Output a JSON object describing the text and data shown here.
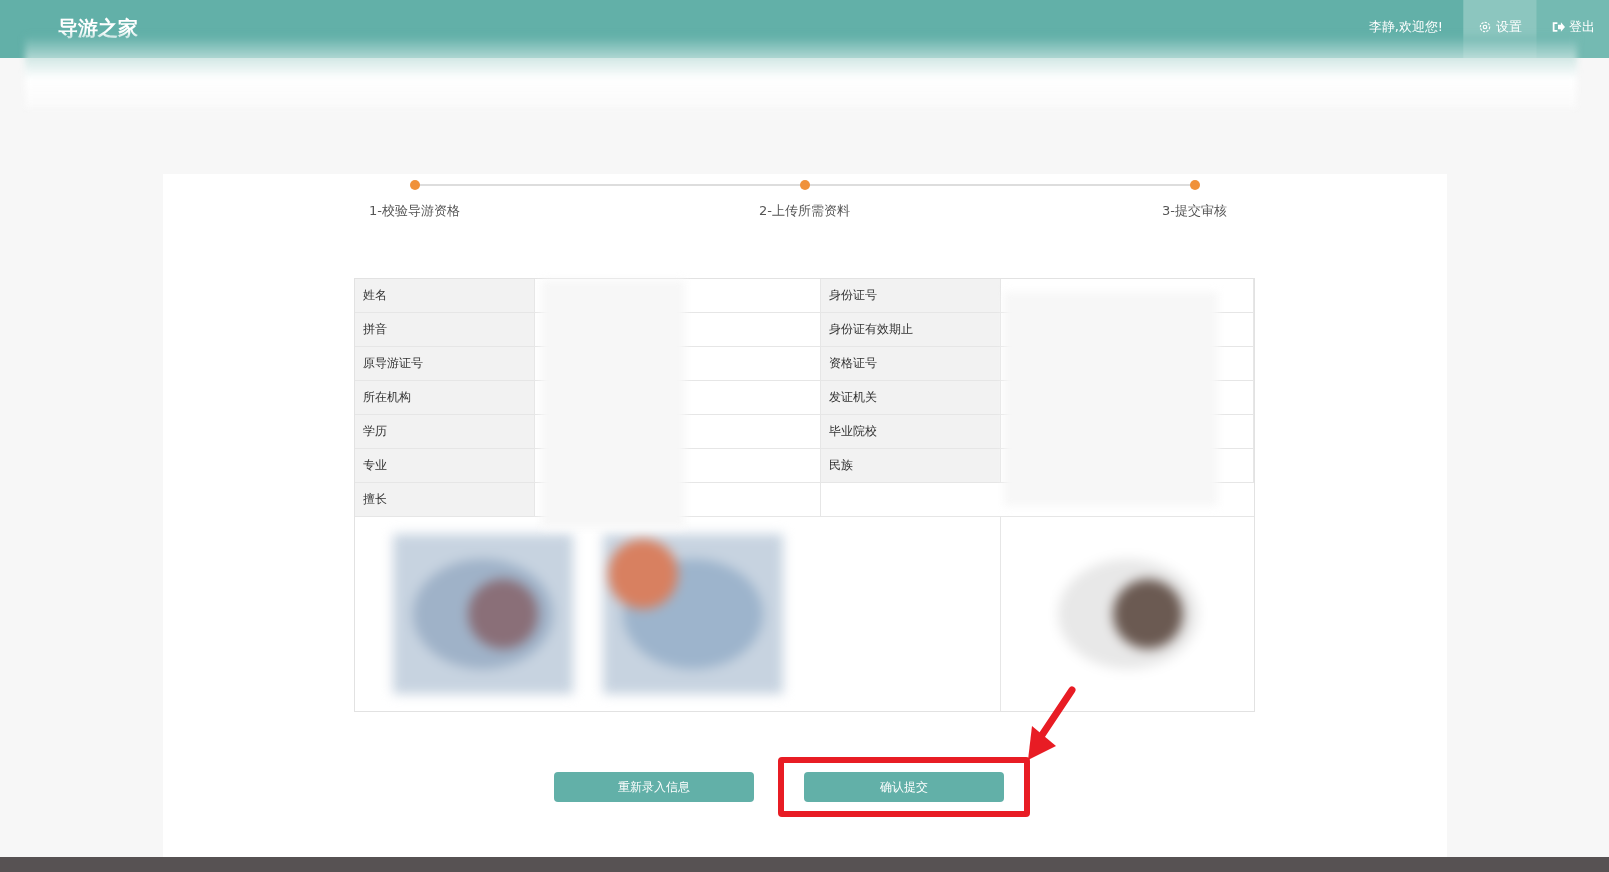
{
  "header": {
    "logo": "导游之家",
    "welcome": "李静,欢迎您!",
    "nav": [
      {
        "kind": "settings",
        "label": "设置",
        "selected": true
      },
      {
        "kind": "logout",
        "label": "登出",
        "selected": false
      }
    ]
  },
  "steps": [
    {
      "label": "1-校验导游资格"
    },
    {
      "label": "2-上传所需资料"
    },
    {
      "label": "3-提交审核"
    }
  ],
  "table": {
    "rows": [
      {
        "left": "姓名",
        "right": "身份证号"
      },
      {
        "left": "拼音",
        "right": "身份证有效期止"
      },
      {
        "left": "原导游证号",
        "right": "资格证号"
      },
      {
        "left": "所在机构",
        "right": "发证机关"
      },
      {
        "left": "学历",
        "right": "毕业院校"
      },
      {
        "left": "专业",
        "right": "民族"
      },
      {
        "left": "擅长"
      }
    ]
  },
  "buttons": [
    {
      "label": "重新录入信息",
      "highlighted": false
    },
    {
      "label": "确认提交",
      "highlighted": true
    }
  ]
}
